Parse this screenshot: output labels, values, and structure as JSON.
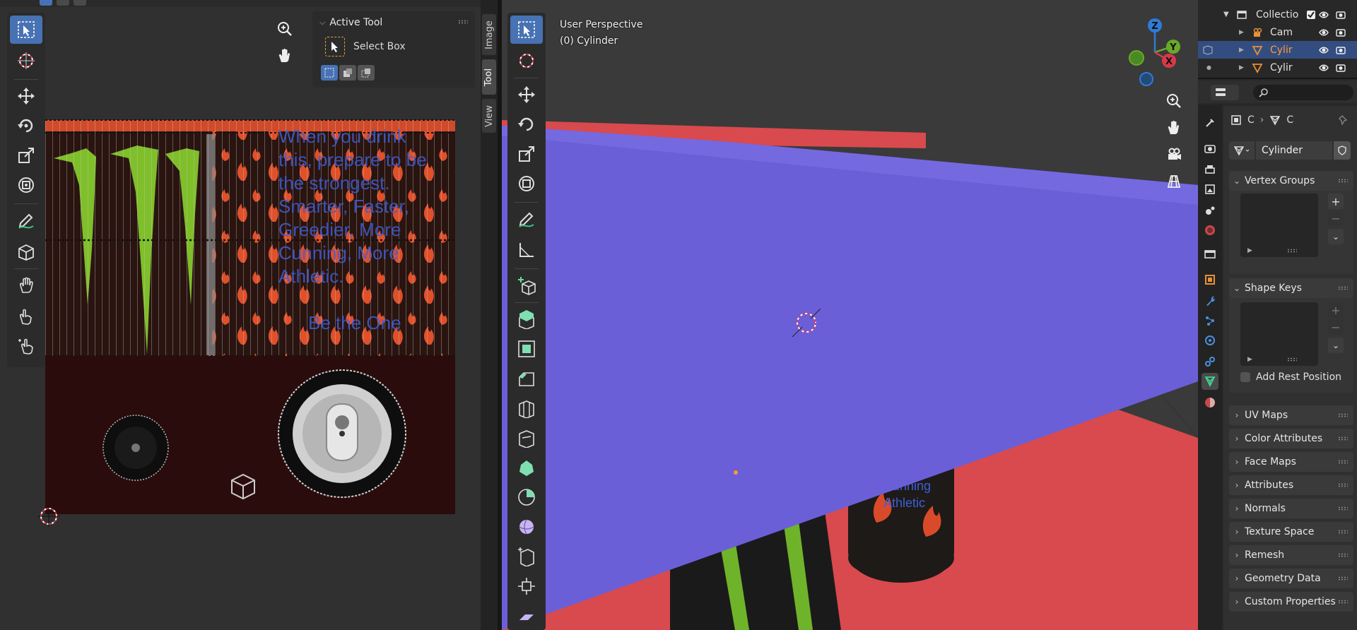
{
  "uv_editor": {
    "sidebar_tabs": [
      "Image",
      "Tool",
      "View"
    ],
    "active_tool_panel": {
      "title": "Active Tool",
      "tool_name": "Select Box"
    },
    "texture_text": {
      "lines": [
        "When you drink",
        "this, prepare to be",
        "the strongest.",
        "Smarter, Faster,",
        "Greedier, More",
        "Cunning, More",
        "Athletic."
      ],
      "tagline": "Be the One"
    }
  },
  "viewport": {
    "perspective_label": "User Perspective",
    "object_label": "(0) Cylinder",
    "axes": {
      "x": "X",
      "y": "Y",
      "z": "Z"
    },
    "colors": {
      "plane": "#6a5bd6",
      "floor": "#d9484b",
      "grid": "#3e3e3e"
    }
  },
  "outliner": {
    "rows": [
      {
        "name": "Collectio",
        "type": "collection"
      },
      {
        "name": "Cam",
        "type": "camera"
      },
      {
        "name": "Cylir",
        "type": "mesh",
        "selected": true
      },
      {
        "name": "Cylir",
        "type": "mesh"
      }
    ]
  },
  "properties": {
    "breadcrumb": [
      "C",
      "C"
    ],
    "mesh_name": "Cylinder",
    "sections": {
      "vertex_groups": "Vertex Groups",
      "shape_keys": "Shape Keys",
      "add_rest_position": "Add Rest Position",
      "uv_maps": "UV Maps",
      "color_attributes": "Color Attributes",
      "face_maps": "Face Maps",
      "attributes": "Attributes",
      "normals": "Normals",
      "texture_space": "Texture Space",
      "remesh": "Remesh",
      "geometry_data": "Geometry Data",
      "custom_properties": "Custom Properties"
    },
    "accent_color": "#4772b3"
  }
}
